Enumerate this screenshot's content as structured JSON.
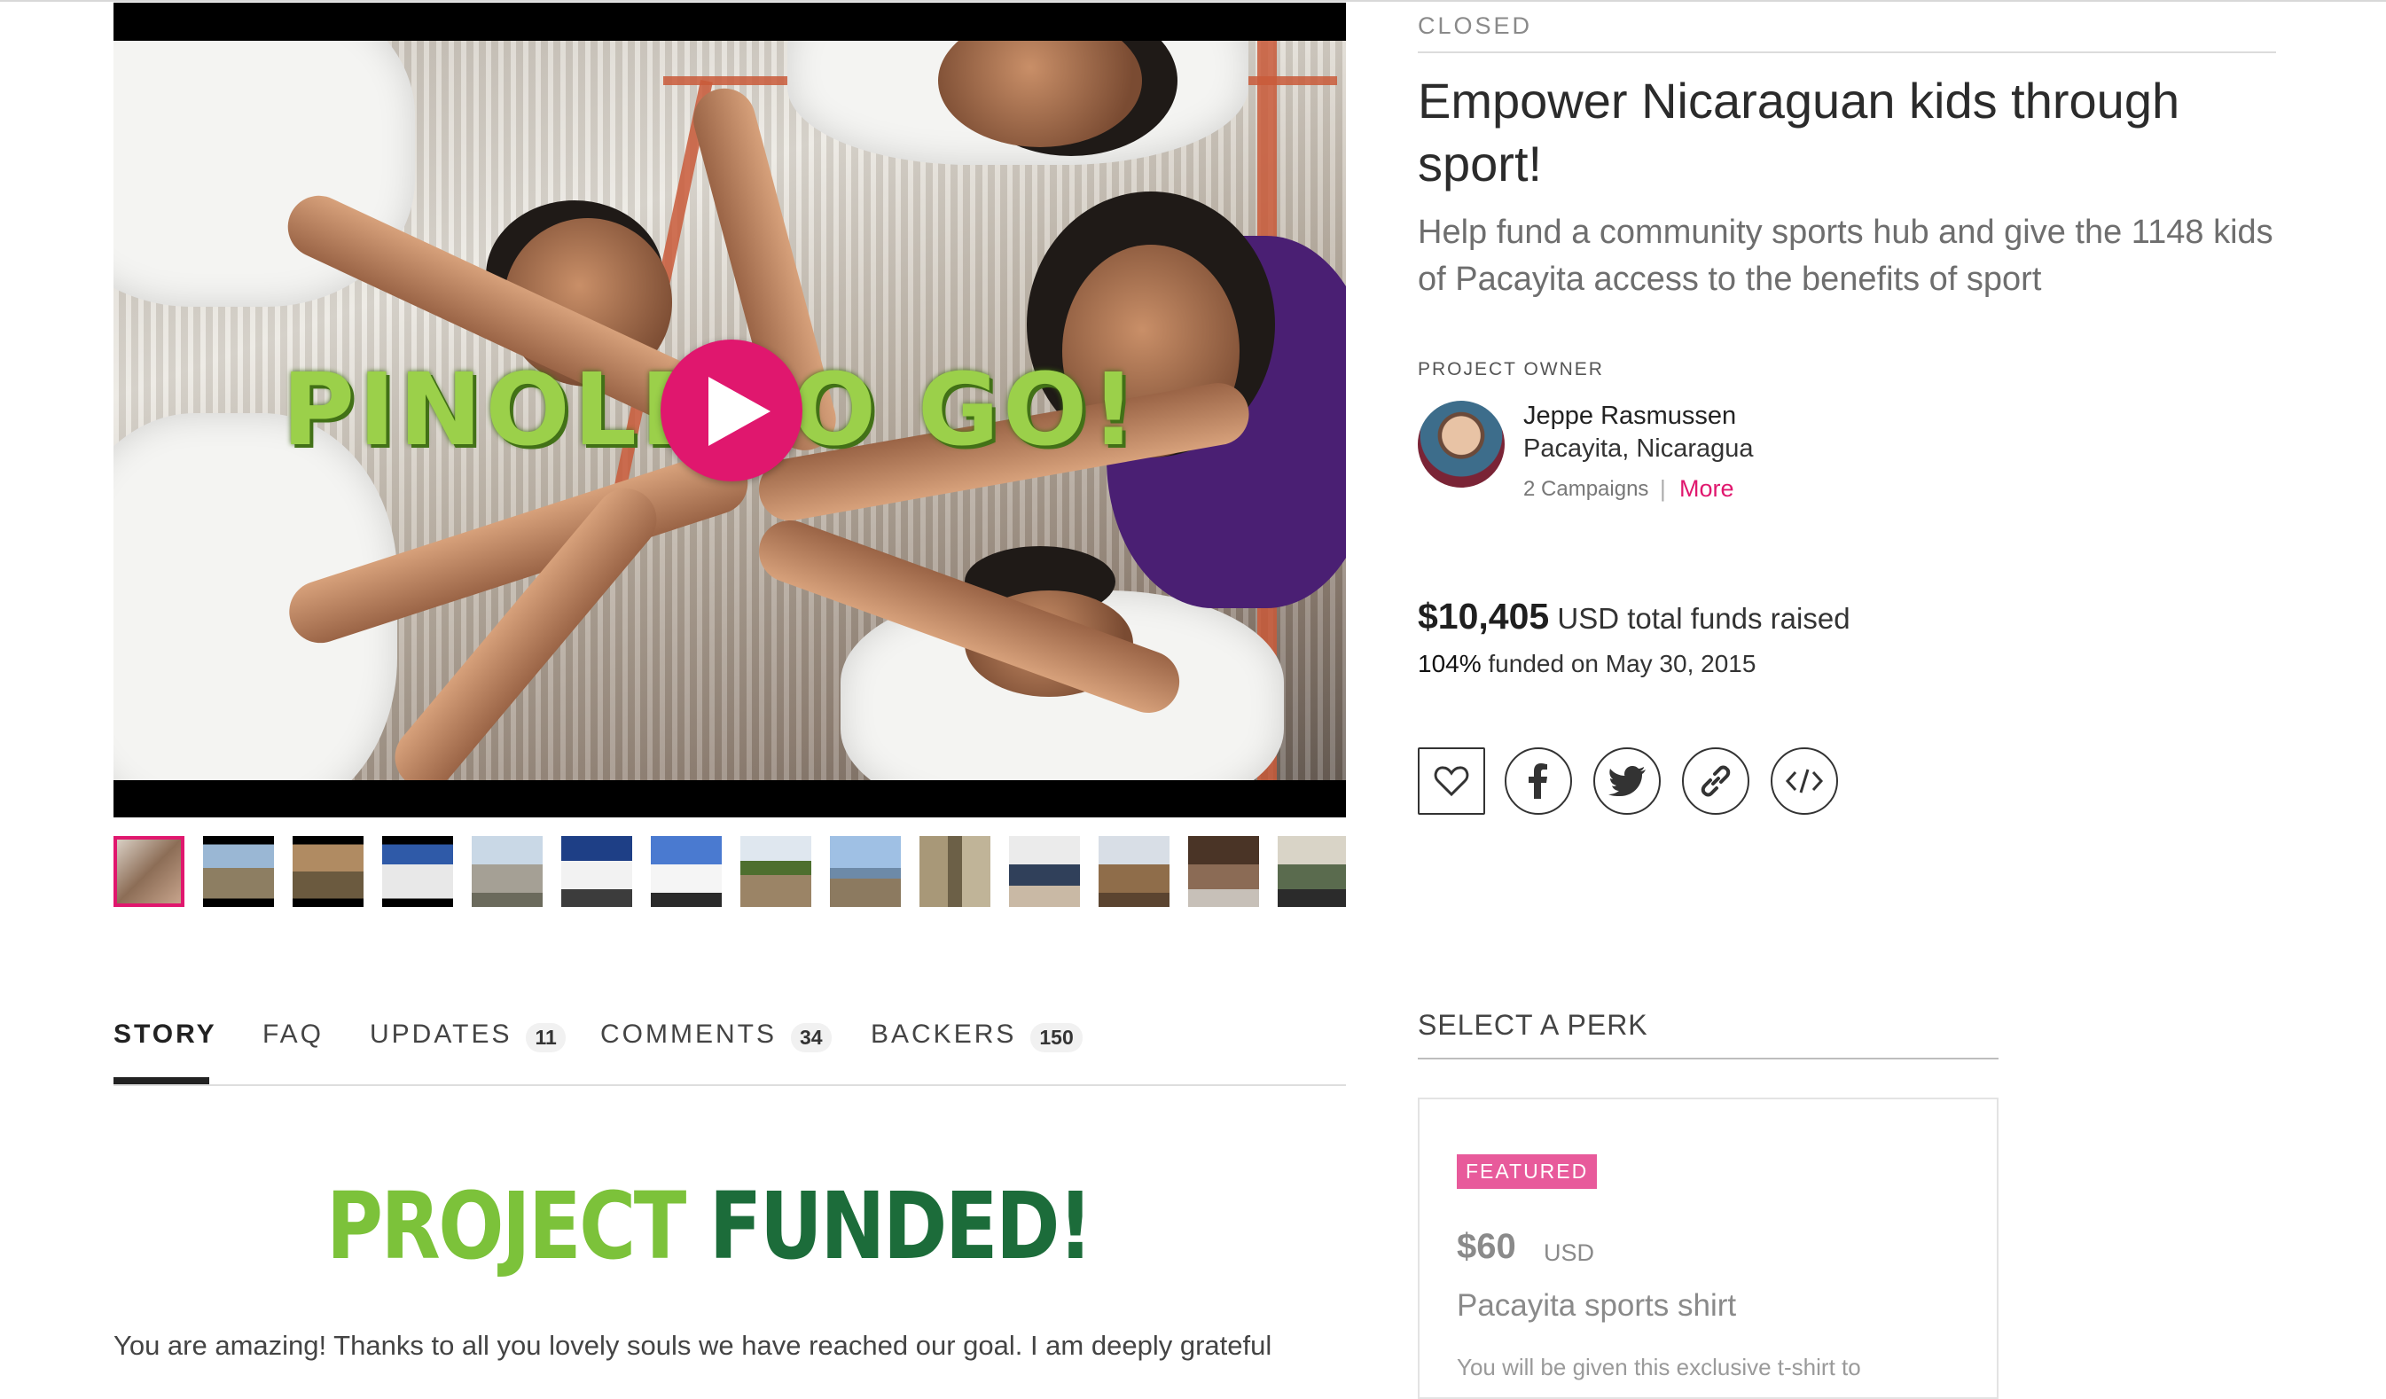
{
  "campaign": {
    "status": "CLOSED",
    "title": "Empower Nicaraguan kids through sport!",
    "tagline": "Help fund a community sports hub and give the 1148 kids of Pacayita access to the benefits of sport"
  },
  "video": {
    "overlay_text": "PINOLERO GO!",
    "play_icon": "play-icon",
    "frame_colors": {
      "accent": "#e0176e",
      "overlay_text": "#9bd04a"
    }
  },
  "gallery": {
    "thumbnails": [
      {
        "label": "thumb-1",
        "active": true
      },
      {
        "label": "thumb-2"
      },
      {
        "label": "thumb-3"
      },
      {
        "label": "thumb-4"
      },
      {
        "label": "thumb-5"
      },
      {
        "label": "thumb-6"
      },
      {
        "label": "thumb-7"
      },
      {
        "label": "thumb-8"
      },
      {
        "label": "thumb-9"
      },
      {
        "label": "thumb-10"
      },
      {
        "label": "thumb-11"
      },
      {
        "label": "thumb-12"
      },
      {
        "label": "thumb-13"
      },
      {
        "label": "thumb-14"
      }
    ]
  },
  "owner": {
    "label": "PROJECT OWNER",
    "name": "Jeppe Rasmussen",
    "location": "Pacayita, Nicaragua",
    "campaigns": "2 Campaigns",
    "separator": "|",
    "more_link": "More"
  },
  "funding": {
    "amount": "$10,405",
    "currency_text": "USD total funds raised",
    "percent": "104%",
    "funded_text": "funded on May 30, 2015"
  },
  "share": {
    "buttons": [
      {
        "icon": "heart-icon"
      },
      {
        "icon": "facebook-icon"
      },
      {
        "icon": "twitter-icon"
      },
      {
        "icon": "link-icon"
      },
      {
        "icon": "embed-icon"
      }
    ]
  },
  "tabs": {
    "story": "STORY",
    "faq": "FAQ",
    "updates": "UPDATES",
    "updates_count": "11",
    "comments": "COMMENTS",
    "comments_count": "34",
    "backers": "BACKERS",
    "backers_count": "150"
  },
  "story": {
    "banner_word1": "PROJECT",
    "banner_word2": "FUNDED!",
    "intro": "You are amazing! Thanks to all you lovely souls we have reached our goal. I am deeply grateful"
  },
  "perks": {
    "heading": "SELECT A PERK",
    "items": [
      {
        "badge": "FEATURED",
        "price": "$60",
        "currency": "USD",
        "name": "Pacayita sports shirt",
        "description": "You will be given this exclusive t-shirt to"
      }
    ]
  },
  "colors": {
    "accent": "#e0176e",
    "featured_badge": "#e85a9b",
    "funded_green": "#7cc23a",
    "funded_dark": "#1c6c3a"
  }
}
